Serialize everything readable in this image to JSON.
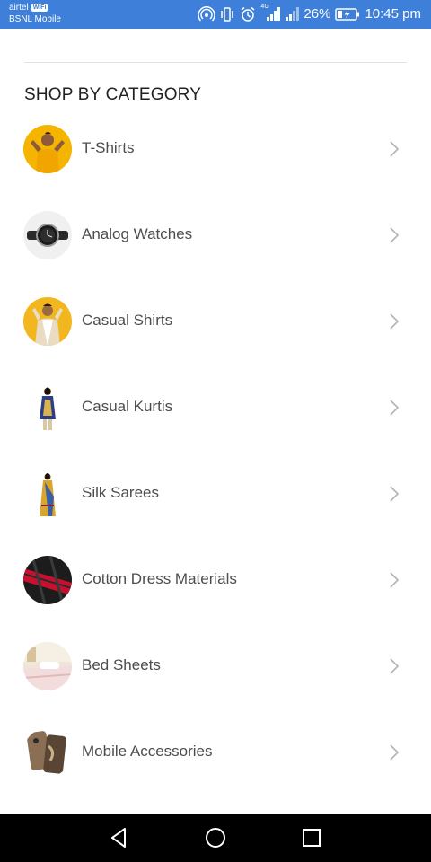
{
  "status_bar": {
    "carrier_primary": "airtel",
    "wifi_badge": "WiFi",
    "carrier_secondary": "BSNL Mobile",
    "network_label": "4G",
    "battery": "26%",
    "time": "10:45 pm",
    "icons": [
      "hotspot-icon",
      "vibrate-icon",
      "alarm-icon",
      "signal-icon",
      "signal-icon",
      "battery-charging-icon"
    ]
  },
  "section": {
    "title": "SHOP BY CATEGORY"
  },
  "categories": [
    {
      "label": "T-Shirts",
      "thumb": "tshirt-model",
      "color": "#f4b400"
    },
    {
      "label": "Analog Watches",
      "thumb": "watch",
      "color": "#f0f0f0"
    },
    {
      "label": "Casual Shirts",
      "thumb": "shirt-model",
      "color": "#f2b61f"
    },
    {
      "label": "Casual Kurtis",
      "thumb": "kurti-model",
      "color": "#ffffff"
    },
    {
      "label": "Silk Sarees",
      "thumb": "saree-model",
      "color": "#ffffff"
    },
    {
      "label": "Cotton Dress Materials",
      "thumb": "fabric",
      "color": "#c8102e"
    },
    {
      "label": "Bed Sheets",
      "thumb": "bedroom",
      "color": "#efe6d8"
    },
    {
      "label": "Mobile Accessories",
      "thumb": "phone-cases",
      "color": "#8a6f55"
    }
  ],
  "nav_bar": {
    "icons": [
      "back-icon",
      "home-icon",
      "recents-icon"
    ]
  }
}
